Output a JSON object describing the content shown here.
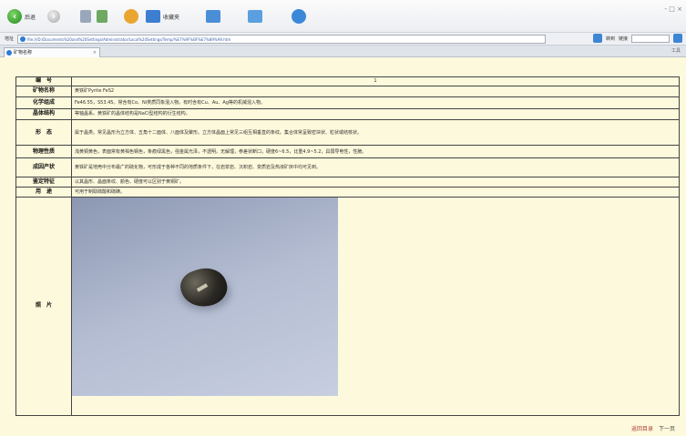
{
  "toolbar": {
    "back_label": "后退",
    "favorites_label": "收藏夹",
    "media_label": "",
    "ie_label": "",
    "window_controls": "- □ ×",
    "icons": [
      "back-icon",
      "forward-icon",
      "stop-icon",
      "refresh-icon",
      "favorites-icon",
      "history-icon",
      "media-icon",
      "internet-icon"
    ]
  },
  "addressbar": {
    "label": "地址",
    "url": "file:///D:/Documents%20and%20Settings/Administrator/Local%20Settings/Temp/%E7%9F%BF%E7%89%A9.htm",
    "go_label": "转到",
    "links_label": "链接"
  },
  "tabbar": {
    "tab_title": "矿物名称",
    "tools_label": "工具"
  },
  "mineral": {
    "header_label": "编　号",
    "header_value": "1",
    "rows": [
      {
        "label": "矿物名称",
        "value": "黄铁矿Pyrite FeS2"
      },
      {
        "label": "化学组成",
        "value": "Fe46.55，S53.45。常含有Co、Ni类质同象混入物。有时含有Cu、Au、Ag等的机械混入物。"
      },
      {
        "label": "晶体结构",
        "value": "等轴晶系。黄铁矿的晶体结构是NaCl型结构的衍生结构。"
      },
      {
        "label": "形　态",
        "value": "属于晶类。常见晶形为立方体、五角十二面体、八面体及聚形。立方体晶面上常见三组互相垂直的条纹。集合体常呈致密块状、粒状或结核状。"
      },
      {
        "label": "物理性质",
        "value": "浅黄铜黄色，表面常有黄褐色锖色，条痕绿黑色，强金属光泽，不透明。无解理，参差状断口，硬度6~6.5，比重4.9~5.2，具弱导电性，性脆。"
      },
      {
        "label": "成因产状",
        "value": "黄铁矿是地壳中分布最广的硫化物，可形成于各种不同的地质条件下，在岩浆岩、沉积岩、变质岩及热液矿床中均可见到。"
      },
      {
        "label": "鉴定特征",
        "value": "以其晶形、晶面条纹、颜色、硬度可以区别于黄铜矿。"
      },
      {
        "label": "用　途",
        "value": "可用于制取硫酸和硫磺。"
      }
    ],
    "photo_label": "照　片",
    "photo_alt": "黄铁矿标本"
  },
  "footer": {
    "home_label": "返回目录",
    "next_label": "下一页"
  },
  "colors": {
    "page_background": "#fdf9dc",
    "table_border": "#444444",
    "footer_link": "#b0413a"
  }
}
